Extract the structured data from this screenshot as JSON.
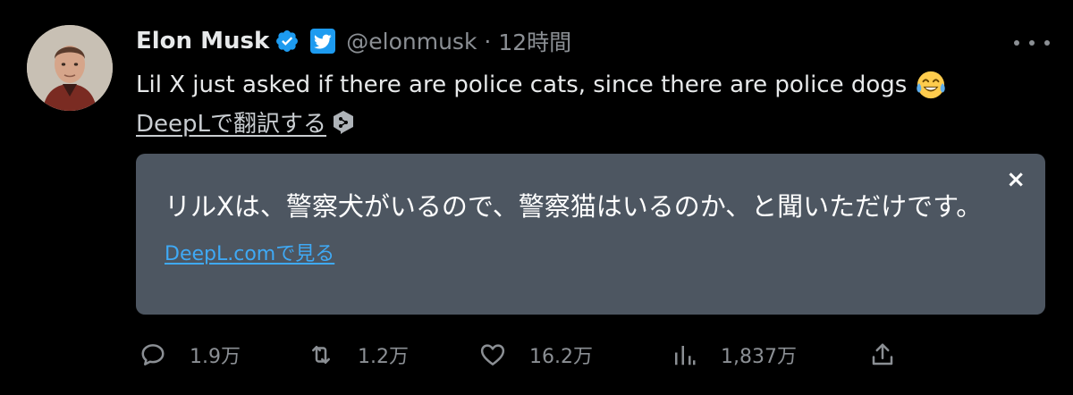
{
  "tweet": {
    "author": {
      "name": "Elon Musk",
      "handle": "@elonmusk",
      "avatar_icon": "avatar-photo",
      "verified_icon": "verified-badge-icon",
      "badge_icon": "twitter-bird-icon"
    },
    "separator": "·",
    "time": "12時間",
    "text": "Lil X just asked if there are police cats, since there are police dogs",
    "emoji": "face-with-tears-of-joy",
    "translate_label": "DeepLで翻訳する"
  },
  "translation": {
    "text": "リルXは、警察犬がいるので、警察猫はいるのか、と聞いただけです。",
    "link_label": "DeepL.comで見る",
    "close_label": "×"
  },
  "actions": {
    "reply_count": "1.9万",
    "retweet_count": "1.2万",
    "like_count": "16.2万",
    "views_count": "1,837万"
  },
  "colors": {
    "background": "#000000",
    "text_primary": "#e7e9ea",
    "text_secondary": "#8b8f94",
    "accent": "#1d9bf0",
    "translation_bg": "#4d5661",
    "translation_link": "#3fa9f5"
  }
}
